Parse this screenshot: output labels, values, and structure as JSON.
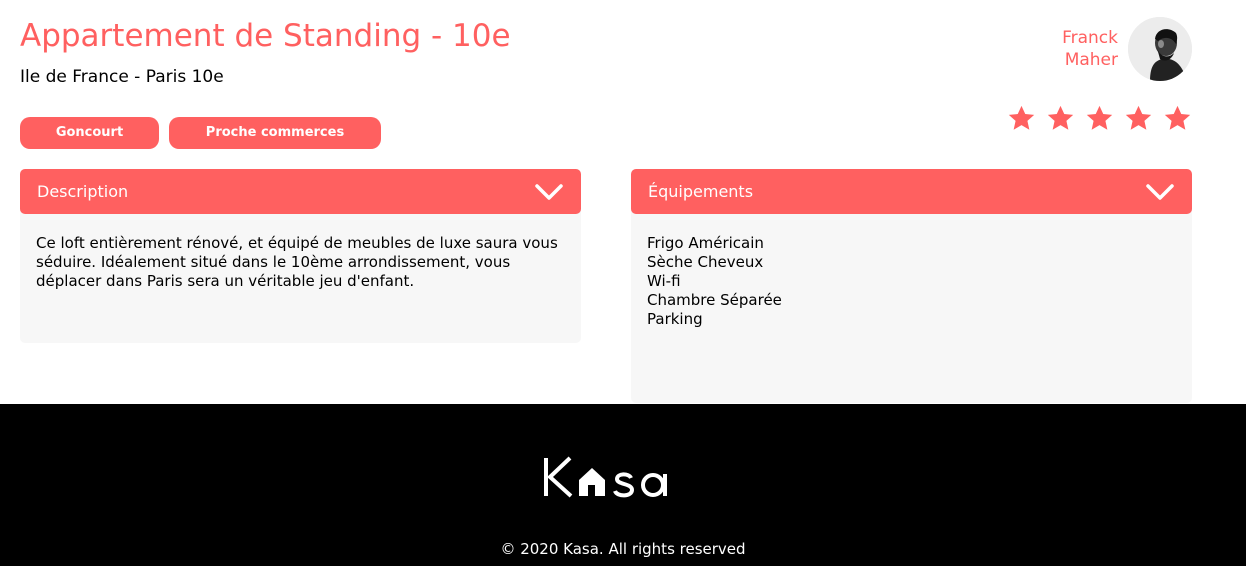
{
  "listing": {
    "title": "Appartement de Standing - 10e",
    "location": "Ile de France - Paris 10e",
    "tags": [
      "Goncourt",
      "Proche commerces"
    ]
  },
  "host": {
    "first_name": "Franck",
    "last_name": "Maher",
    "avatar_icon": "person-avatar-icon"
  },
  "rating": {
    "value": 5,
    "max": 5,
    "icon": "star-icon"
  },
  "description": {
    "label": "Description",
    "text": "Ce loft entièrement rénové, et équipé de meubles de luxe saura vous séduire. Idéalement situé dans le 10ème arrondissement, vous déplacer dans Paris sera un véritable jeu d'enfant."
  },
  "equipments": {
    "label": "Équipements",
    "items": [
      "Frigo Américain",
      "Sèche Cheveux",
      "Wi-fi",
      "Chambre Séparée",
      "Parking"
    ]
  },
  "footer": {
    "logo_text": "Kasa",
    "copyright": "© 2020 Kasa. All rights reserved"
  },
  "colors": {
    "accent": "#FF6060",
    "panel_bg": "#F7F7F7",
    "footer_bg": "#000000"
  }
}
